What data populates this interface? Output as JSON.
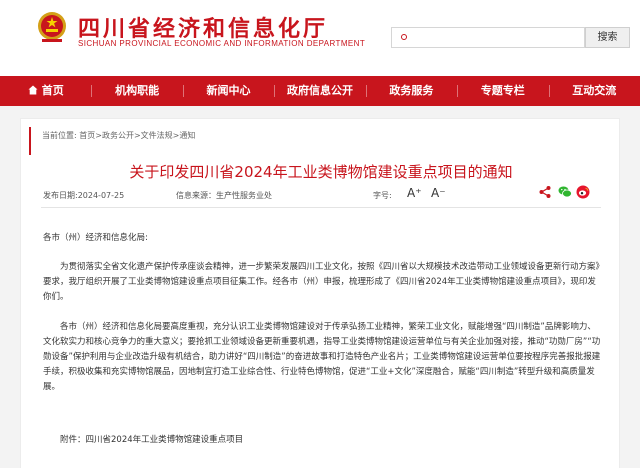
{
  "header": {
    "title": "四川省经济和信息化厅",
    "subtitle": "SICHUAN PROVINCIAL ECONOMIC AND INFORMATION DEPARTMENT",
    "search_placeholder": "",
    "search_button": "搜索"
  },
  "nav": {
    "items": [
      "首页",
      "机构职能",
      "新闻中心",
      "政府信息公开",
      "政务服务",
      "专题专栏",
      "互动交流"
    ]
  },
  "breadcrumb": "当前位置: 首页>政务公开>文件法规>通知",
  "article": {
    "title": "关于印发四川省2024年工业类博物馆建设重点项目的通知",
    "date": "发布日期:2024-07-25",
    "source": "信息来源：生产性服务业处",
    "font_label": "字号:",
    "font_larger": "A⁺",
    "font_smaller": "A⁻",
    "salutation": "各市（州）经济和信息化局:",
    "para1": "为贯彻落实全省文化遗产保护传承座谈会精神，进一步繁荣发展四川工业文化，按照《四川省以大规模技术改造带动工业领域设备更新行动方案》要求，我厅组织开展了工业类博物馆建设重点项目征集工作。经各市（州）申报，梳理形成了《四川省2024年工业类博物馆建设重点项目》，现印发你们。",
    "para2": "各市（州）经济和信息化局要高度重视，充分认识工业类博物馆建设对于传承弘扬工业精神，繁荣工业文化，赋能增强“四川制造”品牌影响力、文化软实力和核心竞争力的重大意义；要抢抓工业领域设备更新重要机遇，指导工业类博物馆建设运营单位与有关企业加强对接，推动“功勋厂房”“功勋设备”保护利用与企业改造升级有机结合，助力讲好“四川制造”的奋进故事和打造特色产业名片；工业类博物馆建设运营单位要按程序完善报批报建手续，积极收集和充实博物馆展品，因地制宜打造工业综合性、行业特色博物馆，促进“工业+文化”深度融合，赋能“四川制造”转型升级和高质量发展。",
    "attachment": "附件：四川省2024年工业类博物馆建设重点项目"
  },
  "colors": {
    "brand_red": "#c8151d",
    "nav_bg": "#c8151d",
    "page_bg": "#f3f3f3"
  },
  "icons": [
    "national-emblem-icon",
    "home-icon",
    "share-icon",
    "wechat-icon",
    "weibo-icon"
  ]
}
